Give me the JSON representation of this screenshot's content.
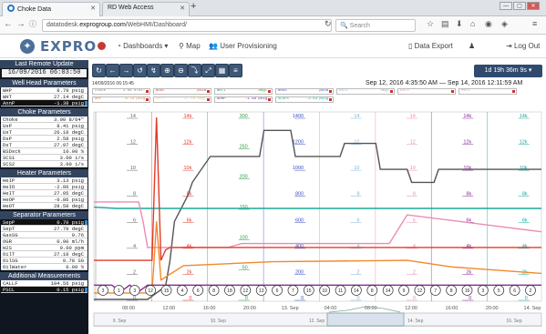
{
  "browser": {
    "tabs": [
      {
        "label": "Choke Data",
        "active": true
      },
      {
        "label": "RD Web Access",
        "active": false
      }
    ],
    "url_prefix": "datatodesk.",
    "url_domain": "exprogroup.com",
    "url_path": "/WebHMI/Dashboard/",
    "search_placeholder": "Search"
  },
  "app": {
    "logo": "EXPRO",
    "nav": [
      {
        "label": "Dashboards ▾"
      },
      {
        "label": "Map"
      },
      {
        "label": "User Provisioning"
      }
    ],
    "data_export": "Data Export",
    "logout": "Log Out"
  },
  "sidebar": {
    "last_update_label": "Last Remote Update",
    "last_update_time": "16/09/2016 06:03:50",
    "sections": [
      {
        "title": "Well Head Parameters",
        "rows": [
          {
            "label": "WHP",
            "value": "8.79 psig",
            "dark": false
          },
          {
            "label": "WHT",
            "value": "27.14 degC",
            "dark": false
          },
          {
            "label": "AnnP",
            "value": "-1.38 psig",
            "dark": true,
            "bell": true
          }
        ]
      },
      {
        "title": "Choke Parameters",
        "rows": [
          {
            "label": "Choke",
            "value": "3.00 8/64\"",
            "dark": false
          },
          {
            "label": "UsP",
            "value": "8.41 psig",
            "dark": false
          },
          {
            "label": "UsT",
            "value": "26.18 degC",
            "dark": false
          },
          {
            "label": "DsP",
            "value": "2.58 psig",
            "dark": false
          },
          {
            "label": "DsT",
            "value": "27.97 degC",
            "dark": false
          },
          {
            "label": "BSDsck",
            "value": "10.00 %",
            "dark": false
          },
          {
            "label": "SCS1",
            "value": "3.00 i/s",
            "dark": false
          },
          {
            "label": "SCS2",
            "value": "3.00 i/s",
            "dark": false
          }
        ]
      },
      {
        "title": "Heater Parameters",
        "rows": [
          {
            "label": "HeIP",
            "value": "3.13 psig",
            "dark": false
          },
          {
            "label": "HeIO",
            "value": "-2.06 psig",
            "dark": false
          },
          {
            "label": "HeIT",
            "value": "27.05 degC",
            "dark": false
          },
          {
            "label": "HeOP",
            "value": "-0.86 psig",
            "dark": false
          },
          {
            "label": "HeOT",
            "value": "28.58 degC",
            "dark": false
          }
        ]
      },
      {
        "title": "Separator Parameters",
        "rows": [
          {
            "label": "SepP",
            "value": "0.70 psig",
            "dark": true,
            "bell": true
          },
          {
            "label": "SepT",
            "value": "27.79 degC",
            "dark": false
          },
          {
            "label": "GasSG",
            "value": "0.76",
            "dark": false
          },
          {
            "label": "OGR",
            "value": "0.90 ml/h",
            "dark": false
          },
          {
            "label": "H2S",
            "value": "0.00 ppm",
            "dark": false
          },
          {
            "label": "OilT",
            "value": "27.18 degC",
            "dark": false
          },
          {
            "label": "OilSG",
            "value": "0.78 SG",
            "dark": false
          },
          {
            "label": "OilWater",
            "value": "0.00 %",
            "dark": false
          }
        ]
      },
      {
        "title": "Additional Measurements",
        "rows": [
          {
            "label": "CALLF",
            "value": "104.56 psig",
            "dark": false
          },
          {
            "label": "PSCL",
            "value": "0.15 psig",
            "dark": true,
            "bell": true
          }
        ]
      }
    ]
  },
  "toolbar": {
    "buttons": [
      "↻",
      "←",
      "→",
      "↺",
      "↯",
      "⊕",
      "⊖",
      "⤵",
      "⤢",
      "▦",
      "≡"
    ],
    "range": "1d 19h 36m 9s ▾"
  },
  "chart_header": {
    "top_date": "14/09/2016 06:15:45",
    "date_range": "Sep 12, 2016 4:35:50 AM — Sep 14, 2016 12:11:59 AM"
  },
  "chips": [
    {
      "label": "Choke",
      "value": "3.00 8/64\"",
      "color": "#888888"
    },
    {
      "label": "BSDL",
      "value": "psia",
      "color": "#e03b2a"
    },
    {
      "label": "WHT1",
      "value": "degC",
      "color": "#2e9e45"
    },
    {
      "label": "BHSS",
      "value": "psia",
      "color": "#3b4fc7"
    },
    {
      "label": "DsT1",
      "value": "degC",
      "color": "#7fb3d5"
    },
    {
      "label": "DsT2",
      "value": "",
      "color": "#e98cb5"
    },
    {
      "label": "MsP2",
      "value": "",
      "color": "#d2a0d8"
    },
    {
      "label": "WHP",
      "value": "8.79 psig",
      "color": "#f08a2a"
    },
    {
      "label": "OilT",
      "value": "27.18 degC",
      "color": "#f2c27a"
    },
    {
      "label": "AnnP",
      "value": "-1.38 psig",
      "color": "#6b2f86"
    },
    {
      "label": "SCSP1",
      "value": "-2.83 psig",
      "color": "#1aa89a"
    }
  ],
  "chart_data": {
    "type": "line",
    "x_ticks": [
      "08:00",
      "12:00",
      "16:00",
      "20:00",
      "13. Sep",
      "04:00",
      "08:00",
      "12:00",
      "16:00",
      "20:00",
      "14. Sep"
    ],
    "nav_labels": [
      "9. Sep",
      "10. Sep",
      "12. Sep",
      "14. Sep",
      "16. Sep"
    ],
    "axes": [
      {
        "ticks": [
          "14",
          "12",
          "10",
          "8",
          "6",
          "4",
          "2",
          "0"
        ],
        "color": "#666666"
      },
      {
        "ticks": [
          "14k",
          "12k",
          "10k",
          "8k",
          "6k",
          "4k",
          "2k",
          "0"
        ],
        "color": "#e03b2a"
      },
      {
        "ticks": [
          "300",
          "250",
          "200",
          "150",
          "100",
          "50",
          "0"
        ],
        "color": "#2e9e45"
      },
      {
        "ticks": [
          "1400",
          "1200",
          "1000",
          "800",
          "600",
          "400",
          "200",
          "0"
        ],
        "color": "#3b4fc7"
      },
      {
        "ticks": [
          "14",
          "12",
          "10",
          "8",
          "6",
          "4",
          "2",
          "0"
        ],
        "color": "#7fb3d5"
      },
      {
        "ticks": [
          "14",
          "12",
          "10",
          "8",
          "6",
          "4",
          "2",
          "0"
        ],
        "color": "#e98cb5"
      },
      {
        "ticks": [
          "14k",
          "12k",
          "10k",
          "8k",
          "6k",
          "4k",
          "2k",
          "0"
        ],
        "color": "#8a2a9a"
      },
      {
        "ticks": [
          "14k",
          "12k",
          "10k",
          "8k",
          "6k",
          "4k",
          "2k",
          "0"
        ],
        "color": "#1aa89a"
      }
    ],
    "event_markers": [
      "3",
      "1",
      "3",
      "12",
      "15",
      "4",
      "6",
      "8",
      "18",
      "12",
      "13",
      "6",
      "7",
      "15",
      "10",
      "11",
      "14",
      "8",
      "14",
      "9",
      "12",
      "7",
      "8",
      "16",
      "3",
      "5",
      "6",
      "2"
    ],
    "series": [
      {
        "color": "#555555",
        "x": [
          0,
          12,
          16,
          17,
          18,
          21,
          22,
          26,
          28,
          29,
          37,
          38,
          44,
          45,
          55,
          56,
          63,
          64,
          70,
          71,
          76,
          77,
          100
        ],
        "y": [
          0,
          0,
          1,
          3,
          6,
          8,
          9,
          11,
          11,
          11,
          11,
          13,
          13,
          11,
          11,
          12,
          12,
          10,
          10,
          9,
          9,
          10,
          10
        ]
      },
      {
        "color": "#2e9e45",
        "x": [
          0,
          8,
          9,
          10,
          12,
          14,
          100
        ],
        "y": [
          60,
          60,
          60,
          50,
          60,
          60,
          60
        ]
      },
      {
        "color": "#1aa89a",
        "x": [
          0,
          5,
          20,
          40,
          60,
          80,
          100
        ],
        "y": [
          7.1,
          7.0,
          7.0,
          7.0,
          7.0,
          7.0,
          7.0
        ]
      },
      {
        "color": "#e98cb5",
        "x": [
          0,
          10,
          11,
          12,
          30,
          33,
          50,
          66,
          70,
          100
        ],
        "y": [
          7.5,
          7.5,
          6,
          4,
          4,
          4.3,
          4.3,
          4.3,
          6.5,
          5.2
        ]
      },
      {
        "color": "#e03b2a",
        "x": [
          0,
          13,
          14,
          15,
          16,
          17,
          40,
          70,
          100
        ],
        "y": [
          3,
          3,
          14,
          3,
          3.8,
          4,
          4,
          4,
          4
        ]
      },
      {
        "color": "#f08a2a",
        "x": [
          0,
          13,
          14,
          15,
          20,
          40,
          70,
          80,
          100
        ],
        "y": [
          0.5,
          0.5,
          6,
          1.5,
          2.6,
          2.9,
          3,
          2.5,
          2
        ]
      },
      {
        "color": "#8a2a9a",
        "x": [
          0,
          2,
          4,
          6,
          8,
          10,
          12,
          14,
          100
        ],
        "y": [
          1.1,
          1.1,
          1.1,
          0.6,
          1.1,
          0.6,
          1.1,
          1.1,
          1.1
        ]
      }
    ]
  }
}
